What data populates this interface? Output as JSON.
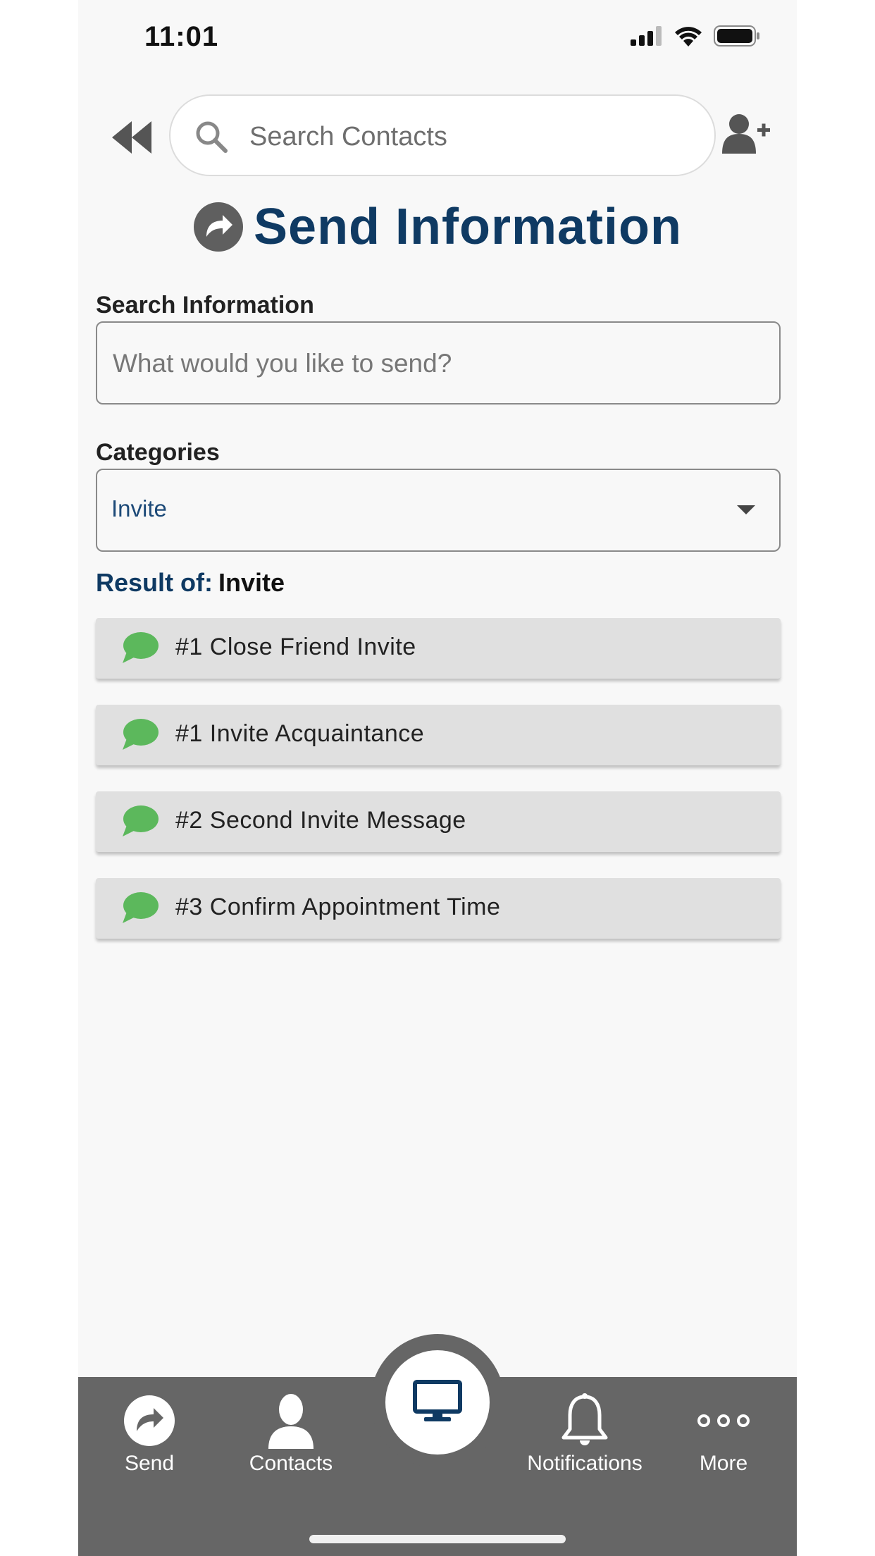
{
  "status_bar": {
    "time": "11:01"
  },
  "header": {
    "search_placeholder": "Search Contacts"
  },
  "page": {
    "title": "Send Information"
  },
  "form": {
    "search_label": "Search Information",
    "search_placeholder": "What would you like to send?",
    "categories_label": "Categories",
    "categories_selected": "Invite"
  },
  "results": {
    "prefix": "Result of:",
    "value": "Invite",
    "items": [
      {
        "label": "#1 Close Friend Invite",
        "icon": "chat-bubble-icon"
      },
      {
        "label": "#1 Invite Acquaintance",
        "icon": "chat-bubble-icon"
      },
      {
        "label": "#2 Second Invite Message",
        "icon": "chat-bubble-icon"
      },
      {
        "label": "#3 Confirm Appointment Time",
        "icon": "chat-bubble-icon"
      }
    ]
  },
  "bottom_nav": {
    "items": [
      {
        "label": "Send",
        "icon": "send-icon"
      },
      {
        "label": "Contacts",
        "icon": "contact-icon"
      },
      {
        "label": "",
        "icon": "monitor-icon"
      },
      {
        "label": "Notifications",
        "icon": "bell-icon"
      },
      {
        "label": "More",
        "icon": "more-icon"
      }
    ]
  },
  "colors": {
    "title": "#0f3a63",
    "select_value": "#1d4a78",
    "chat_icon": "#5cb85c",
    "nav_background": "#666666",
    "item_background": "#e0e0e0"
  }
}
